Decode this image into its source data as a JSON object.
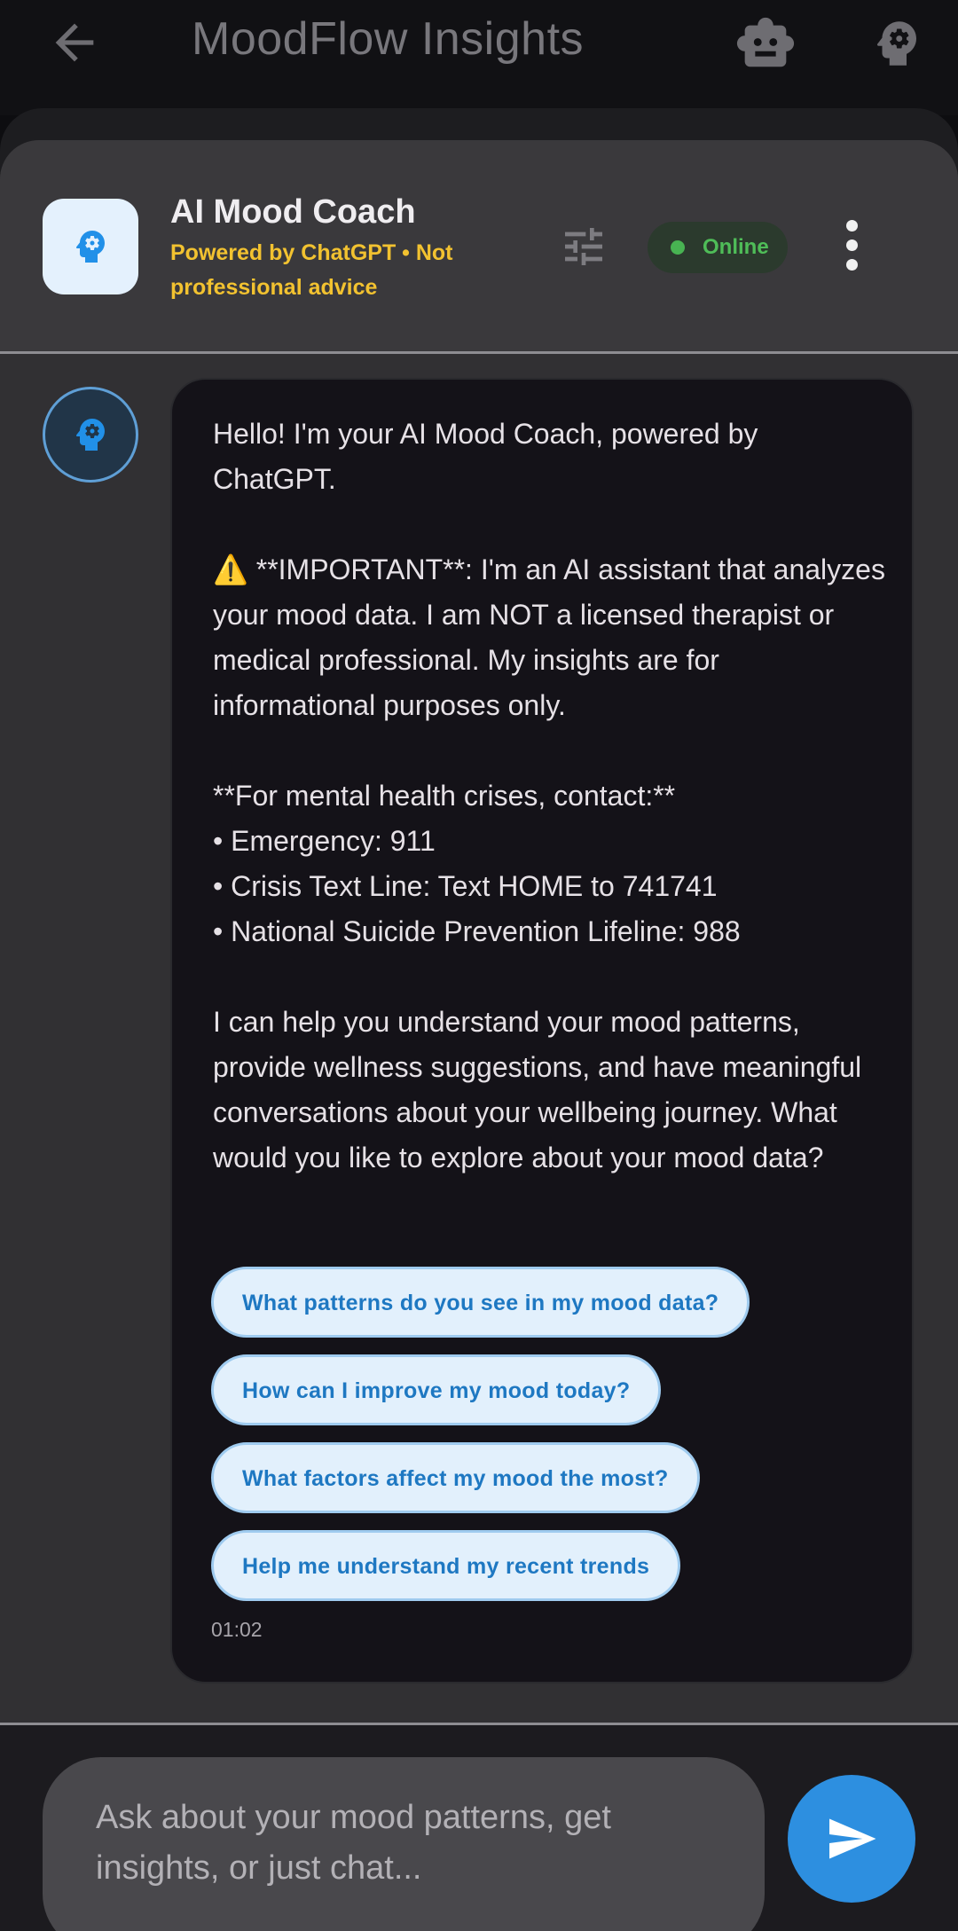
{
  "appbar": {
    "title": "MoodFlow Insights"
  },
  "header": {
    "title": "AI Mood Coach",
    "subtitle": "Powered by ChatGPT • Not professional advice",
    "status": "Online"
  },
  "message": {
    "greeting": "Hello! I'm your AI Mood Coach, powered by ChatGPT.",
    "warning_emoji": "⚠️",
    "important": " **IMPORTANT**: I'm an AI assistant that analyzes your mood data. I am NOT a licensed therapist or medical professional. My insights are for informational purposes only.",
    "crisis_header": "**For mental health crises, contact:**",
    "crisis_lines": [
      "• Emergency: 911",
      "• Crisis Text Line: Text HOME to 741741",
      "• National Suicide Prevention Lifeline: 988"
    ],
    "closing": "I can help you understand your mood patterns, provide wellness suggestions, and have meaningful conversations about your wellbeing journey. What would you like to explore about your mood data?",
    "suggestions": [
      "What patterns do you see in my mood data?",
      "How can I improve my mood today?",
      "What factors affect my mood the most?",
      "Help me understand my recent trends"
    ],
    "time": "01:02"
  },
  "input": {
    "placeholder": "Ask about your mood patterns, get insights, or just chat..."
  },
  "colors": {
    "accent": "#2d8fe0",
    "warning": "#f2c230",
    "online": "#4fbd58"
  },
  "icons": [
    "back-arrow-icon",
    "robot-icon",
    "psychology-icon",
    "tune-icon",
    "more-vert-icon",
    "send-icon"
  ]
}
